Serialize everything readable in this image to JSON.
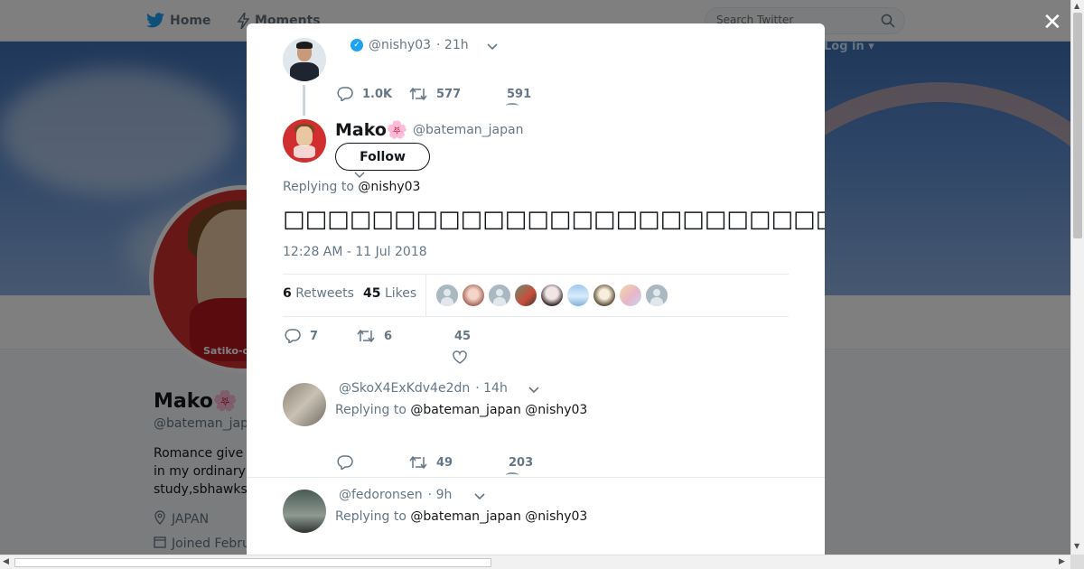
{
  "nav": {
    "home_label": "Home",
    "moments_label": "Moments",
    "search_placeholder": "Search Twitter",
    "login_label": "Log in"
  },
  "profile": {
    "name": "Mako🌸",
    "handle": "@bateman_jap",
    "bio_line1": "Romance give",
    "bio_line2": "in my ordinary",
    "bio_line3": "study,sbhawks",
    "location": "JAPAN",
    "joined": "Joined Febru",
    "avatar_brand": "Satiko-c"
  },
  "modal": {
    "close_label": "✕",
    "parent_tweet": {
      "handle": "@nishy03",
      "time": "· 21h",
      "replies": "1.0K",
      "retweets": "577",
      "likes": "591"
    },
    "main_tweet": {
      "name": "Mako🌸",
      "handle": "@bateman_japan",
      "follow_label": "Follow",
      "replying_prefix": "Replying to",
      "replying_mention": "@nishy03",
      "text": "□□□□□□□□□□□□□□□□□□□□□□□□□□□□□□□□□□□□□□□□□□□□□□□□□□□□□□□□□",
      "timestamp": "12:28 AM - 11 Jul 2018",
      "retweets_count": "6",
      "retweets_label": "Retweets",
      "likes_count": "45",
      "likes_label": "Likes",
      "replies": "7",
      "retweets": "6",
      "likes": "45"
    },
    "replies": [
      {
        "handle": "@SkoX4ExKdv4e2dn",
        "time": "· 14h",
        "replying_prefix": "Replying to",
        "mentions": "@bateman_japan @nishy03",
        "replies": "",
        "retweets": "49",
        "likes": "203"
      },
      {
        "handle": "@fedoronsen",
        "time": "· 9h",
        "replying_prefix": "Replying to",
        "mentions": "@bateman_japan @nishy03"
      }
    ]
  },
  "colors": {
    "twitter_blue": "#1da1f2",
    "muted_text": "#657786",
    "mako_red": "#d12f2f"
  }
}
